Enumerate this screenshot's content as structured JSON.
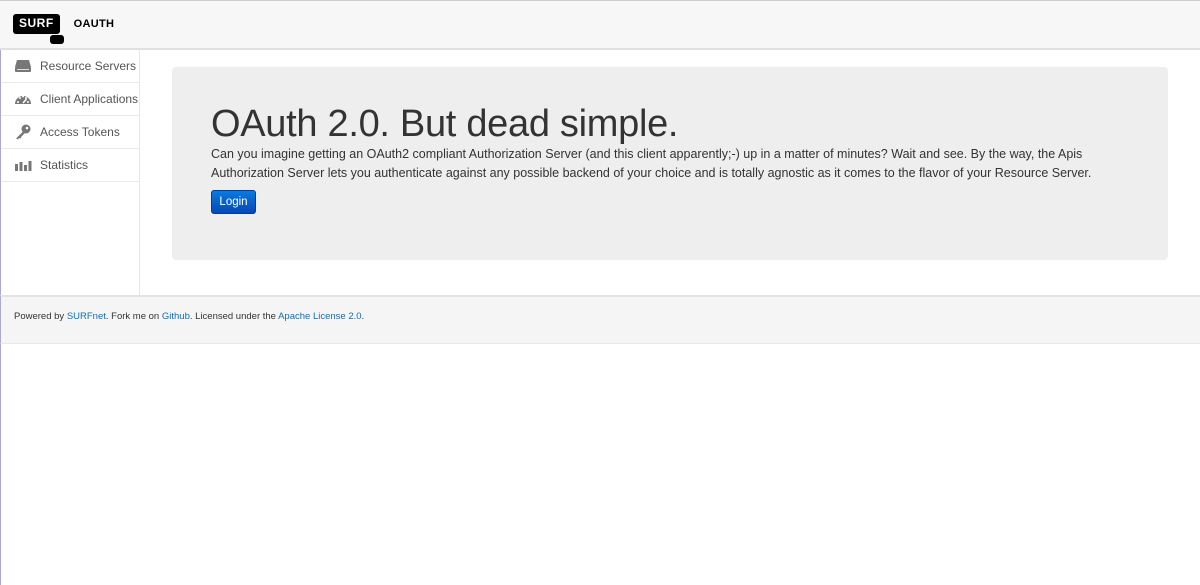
{
  "header": {
    "brand_surf": "SURF",
    "brand_oauth": "OAUTH"
  },
  "sidebar": {
    "items": [
      {
        "label": "Resource Servers",
        "icon": "server-icon"
      },
      {
        "label": "Client Applications",
        "icon": "dashboard-icon"
      },
      {
        "label": "Access Tokens",
        "icon": "key-icon"
      },
      {
        "label": "Statistics",
        "icon": "bar-chart-icon"
      }
    ]
  },
  "hero": {
    "title": "OAuth 2.0. But dead simple.",
    "text": "Can you imagine getting an OAuth2 compliant Authorization Server (and this client apparently;-) up in a matter of minutes? Wait and see. By the way, the Apis Authorization Server lets you authenticate against any possible backend of your choice and is totally agnostic as it comes to the flavor of your Resource Server.",
    "login_label": "Login"
  },
  "footer": {
    "powered_by": "Powered by ",
    "surfnet_link": "SURFnet",
    "fork_text": ". Fork me on ",
    "github_link": "Github",
    "licensed_text": ". Licensed under the ",
    "license_link": "Apache License 2.0",
    "end_text": "."
  },
  "colors": {
    "accent": "#0648b8",
    "link": "#0a6fc2",
    "hero_bg": "#eeeeee"
  }
}
